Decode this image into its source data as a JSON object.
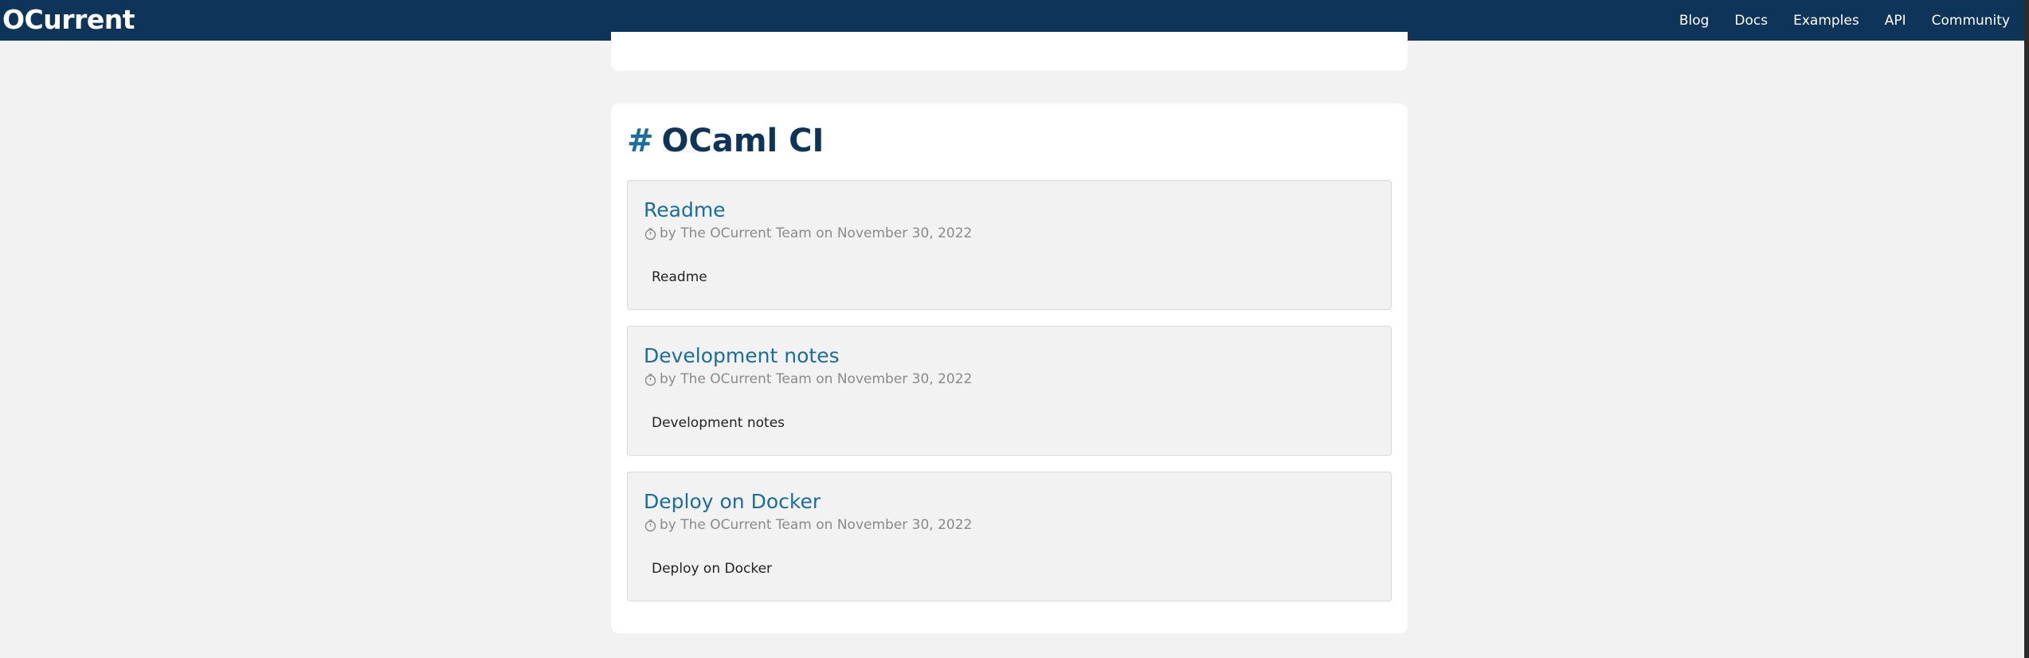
{
  "nav": {
    "brand": "OCurrent",
    "links": [
      "Blog",
      "Docs",
      "Examples",
      "API",
      "Community"
    ]
  },
  "section": {
    "hash": "#",
    "title": "OCaml CI"
  },
  "posts": [
    {
      "title": "Readme",
      "meta": "by The OCurrent Team on November 30, 2022",
      "excerpt": "Readme"
    },
    {
      "title": "Development notes",
      "meta": "by The OCurrent Team on November 30, 2022",
      "excerpt": "Development notes"
    },
    {
      "title": "Deploy on Docker",
      "meta": "by The OCurrent Team on November 30, 2022",
      "excerpt": "Deploy on Docker"
    }
  ],
  "icons": {
    "meta": "clock-icon"
  },
  "colors": {
    "navbar": "#0e3559",
    "link": "#1a6d9e",
    "background": "#f2f2f2"
  }
}
